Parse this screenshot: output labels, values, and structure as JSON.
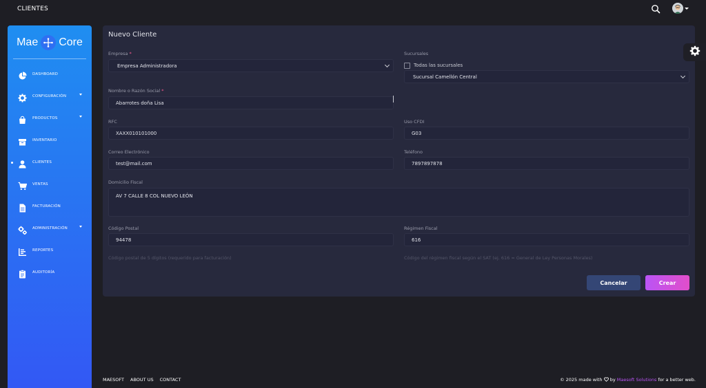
{
  "topbar": {
    "title": "CLIENTES",
    "search_icon": "search-icon",
    "user_icon": "user-avatar-icon"
  },
  "sidebar": {
    "logo_left": "Mae",
    "logo_right": "Core",
    "items": [
      {
        "label": "DASHBOARD",
        "icon": "pie-chart-icon",
        "has_submenu": false
      },
      {
        "label": "CONFIGURACIÓN",
        "icon": "gear-icon",
        "has_submenu": true
      },
      {
        "label": "PRODUCTOS",
        "icon": "shopping-bag-icon",
        "has_submenu": true
      },
      {
        "label": "INVENTARIO",
        "icon": "archive-box-icon",
        "has_submenu": false
      },
      {
        "label": "CLIENTES",
        "icon": "user-icon",
        "has_submenu": false,
        "active": true
      },
      {
        "label": "VENTAS",
        "icon": "cart-icon",
        "has_submenu": false
      },
      {
        "label": "FACTURACIÓN",
        "icon": "document-icon",
        "has_submenu": false
      },
      {
        "label": "ADMINISTRACIÓN",
        "icon": "gears-icon",
        "has_submenu": true
      },
      {
        "label": "REPORTES",
        "icon": "bar-list-icon",
        "has_submenu": false
      },
      {
        "label": "AUDITORÍA",
        "icon": "clipboard-icon",
        "has_submenu": false
      }
    ]
  },
  "form": {
    "title": "Nuevo Cliente",
    "empresa": {
      "label": "Empresa",
      "value": "Empresa Administradora"
    },
    "sucursales": {
      "label": "Sucursales",
      "checkbox_label": "Todas las sucursales",
      "checked": false,
      "value": "Sucursal Camellón Central"
    },
    "nombre": {
      "label": "Nombre o Razón Social",
      "value": "Abarrotes doña Lisa"
    },
    "rfc": {
      "label": "RFC",
      "value": "XAXX010101000"
    },
    "uso_cfdi": {
      "label": "Uso CFDI",
      "value": "G03"
    },
    "correo": {
      "label": "Correo Electrónico",
      "value": "test@mail.com"
    },
    "telefono": {
      "label": "Teléfono",
      "value": "7897897878"
    },
    "domicilio": {
      "label": "Domicilio Fiscal",
      "value": "AV 7 CALLE 8 COL NUEVO LEÓN"
    },
    "codigo_postal": {
      "label": "Código Postal",
      "value": "94478",
      "hint": "Código postal de 5 dígitos (requerido para facturación)"
    },
    "regimen": {
      "label": "Régimen Fiscal",
      "value": "616",
      "hint": "Código del régimen fiscal según el SAT (ej. 616 = General de Ley Personas Morales)"
    },
    "required_mark": "*",
    "cancel_label": "Cancelar",
    "create_label": "Crear"
  },
  "footer": {
    "links": [
      "MAESOFT",
      "ABOUT US",
      "CONTACT"
    ],
    "copy_prefix": "© 2025 made with",
    "copy_by": "by",
    "brand": "Maesoft Solutions",
    "copy_suffix": "for a better web."
  },
  "colors": {
    "background": "#1e1e24",
    "card": "#27293d",
    "sidebar_top": "#1f8ef1",
    "sidebar_bottom": "#3358f4",
    "accent": "#e14eca",
    "cancel": "#344675"
  }
}
